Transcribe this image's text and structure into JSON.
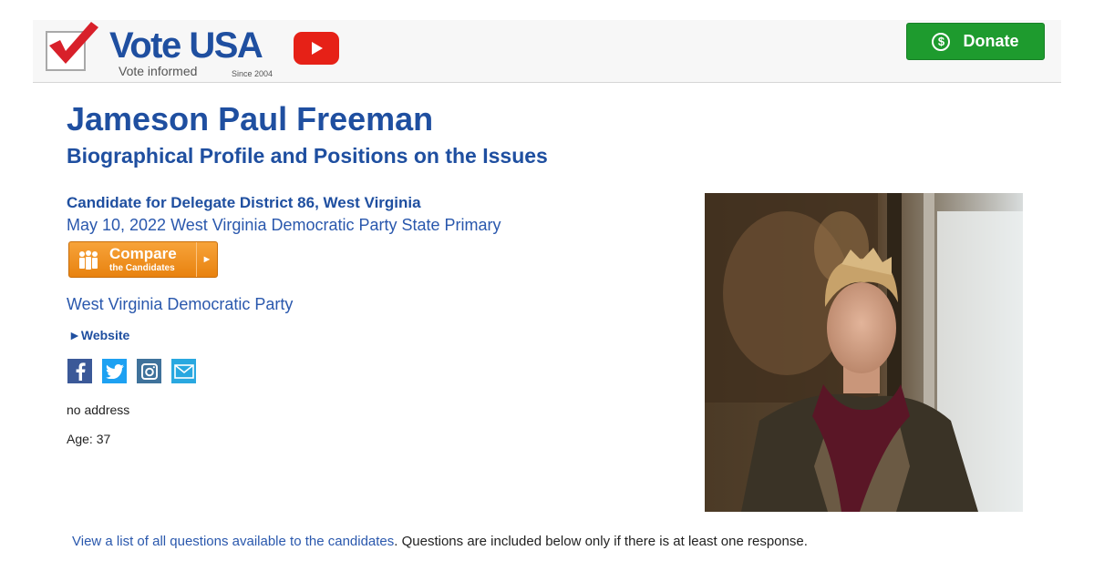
{
  "header": {
    "logo_title": "Vote USA",
    "logo_tagline": "Vote informed",
    "logo_since": "Since 2004",
    "youtube_icon": "youtube-icon",
    "donate_label": "Donate",
    "donate_symbol": "$",
    "colors": {
      "brand_blue": "#1f4fa0",
      "donate_green": "#1e9b2e",
      "youtube_red": "#e62117"
    }
  },
  "candidate": {
    "name": "Jameson Paul Freeman",
    "subtitle": "Biographical Profile and Positions on the Issues",
    "office": "Candidate for Delegate District 86, West Virginia",
    "election": "May 10, 2022 West Virginia Democratic Party State Primary",
    "party": "West Virginia Democratic Party",
    "website_label": "►Website",
    "address": "no address",
    "age": "Age: 37",
    "photo_alt": "candidate-photo"
  },
  "compare": {
    "label": "Compare",
    "sublabel": "the Candidates",
    "arrow": "►",
    "color": "#f29422"
  },
  "social": [
    "facebook-icon",
    "twitter-icon",
    "instagram-icon",
    "email-icon"
  ],
  "questions": {
    "link_text": "View a list of all questions available to the candidates",
    "rest_text": ". Questions are included below only if there is at least one response."
  }
}
